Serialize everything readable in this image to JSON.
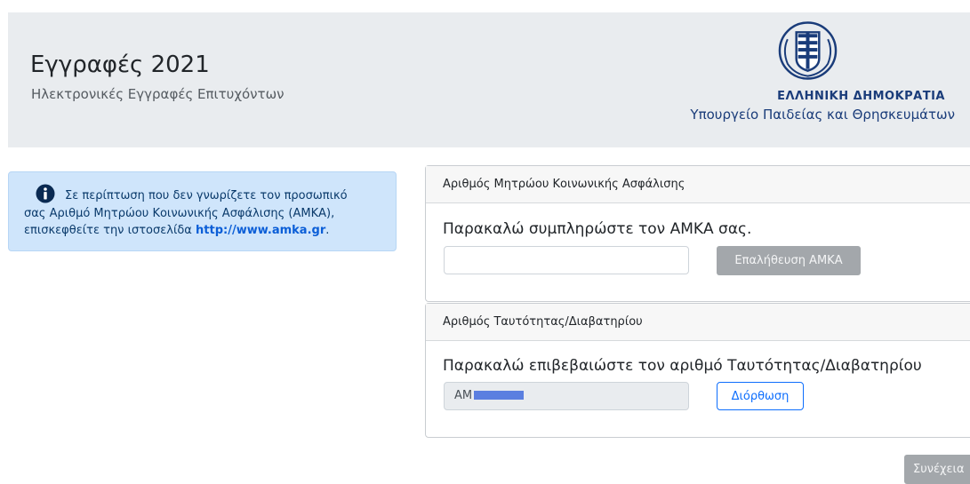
{
  "header": {
    "title": "Εγγραφές 2021",
    "subtitle": "Ηλεκτρονικές Εγγραφές Επιτυχόντων",
    "government_name": "ΕΛΛΗΝΙΚΗ ΔΗΜΟΚΡΑΤΙΑ",
    "ministry_name": "Υπουργείο Παιδείας και Θρησκευμάτων",
    "emblem_icon": "greek-state-emblem-icon"
  },
  "info_alert": {
    "icon": "info-circle-icon",
    "line1": "Σε περίπτωση που δεν γνωρίζετε τον προσωπικό",
    "line2": "σας Αριθμό Μητρώου Κοινωνικής Ασφάλισης (ΑΜΚΑ),",
    "line3_prefix": "επισκεφθείτε την ιστοσελίδα ",
    "link_text": "http://www.amka.gr",
    "line3_suffix": "."
  },
  "amka_card": {
    "header": "Αριθμός Μητρώου Κοινωνικής Ασφάλισης",
    "prompt": "Παρακαλώ συμπληρώστε τον ΑΜΚΑ σας.",
    "input_value": "",
    "verify_button": "Επαλήθευση ΑΜΚΑ"
  },
  "id_card": {
    "header": "Αριθμός Ταυτότητας/Διαβατηρίου",
    "prompt": "Παρακαλώ επιβεβαιώστε τον αριθμό Ταυτότητας/Διαβατηρίου",
    "id_value_prefix": "ΑΜ",
    "correct_button": "Διόρθωση"
  },
  "footer": {
    "continue_button": "Συνέχεια"
  },
  "colors": {
    "header_bg": "#e9ecef",
    "alert_bg": "#cfe5fb",
    "primary": "#0d6efd",
    "disabled_button": "#a3a7ab",
    "gov_blue": "#1a3c7a"
  }
}
